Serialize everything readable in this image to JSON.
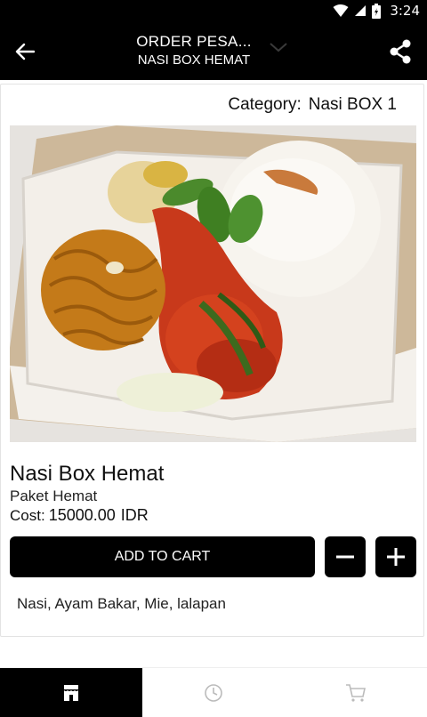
{
  "status_bar": {
    "time": "3:24"
  },
  "app_bar": {
    "title": "ORDER PESA...",
    "subtitle": "NASI BOX HEMAT"
  },
  "product": {
    "category_label": "Category:",
    "category_value": "Nasi BOX 1",
    "name": "Nasi Box Hemat",
    "package": "Paket Hemat",
    "cost_label": "Cost:",
    "cost_value": "15000.00",
    "currency": "IDR",
    "add_to_cart_label": "ADD TO CART",
    "ingredients": "Nasi, Ayam Bakar, Mie, lalapan"
  },
  "bottom_nav": {
    "tabs": [
      {
        "icon": "store-icon",
        "active": true
      },
      {
        "icon": "clock-icon",
        "active": false
      },
      {
        "icon": "cart-icon",
        "active": false
      }
    ]
  },
  "colors": {
    "app_bar_bg": "#000000",
    "button_bg": "#000000",
    "accent_text": "#ffffff"
  }
}
